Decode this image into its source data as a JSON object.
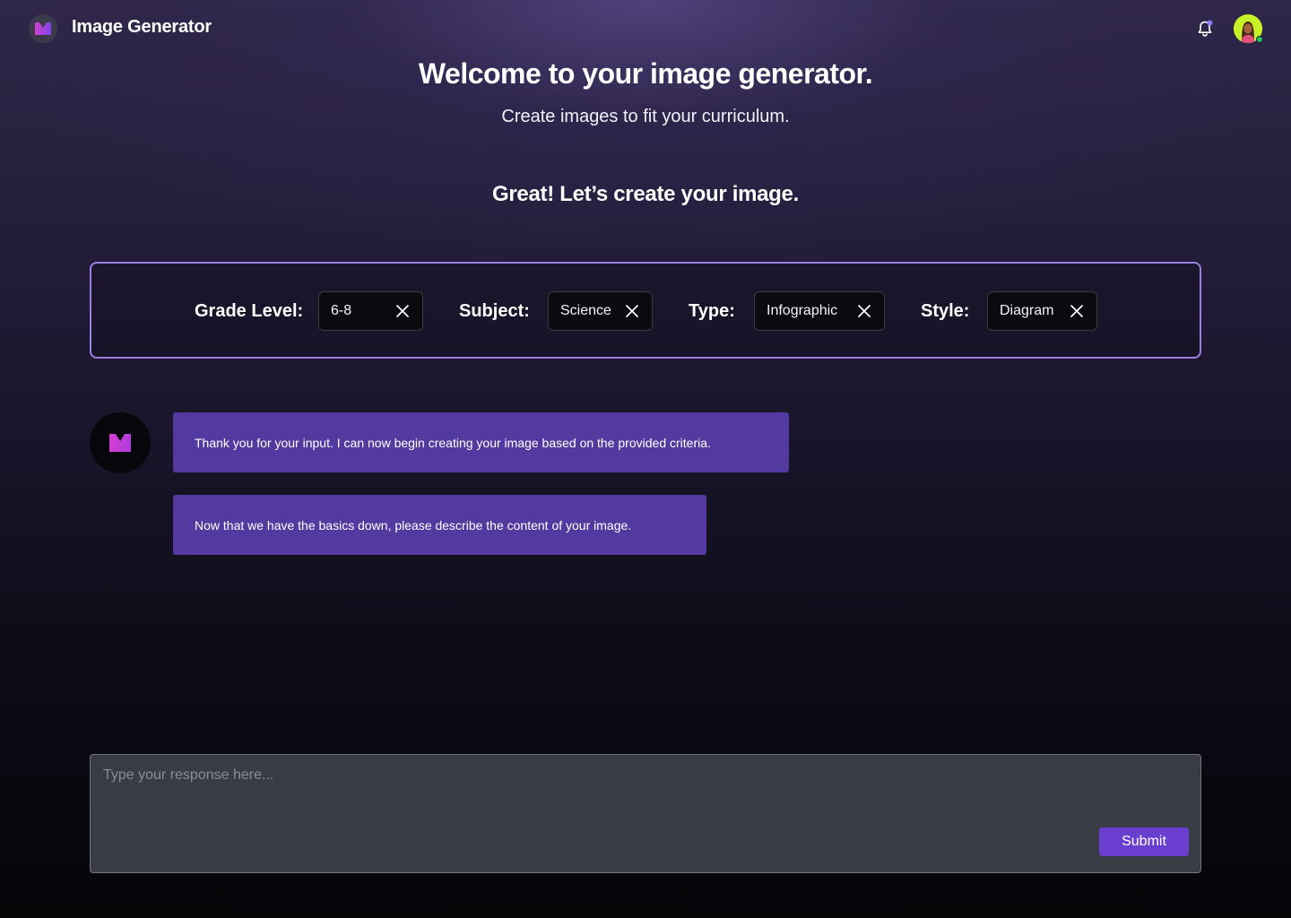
{
  "header": {
    "app_title": "Image Generator",
    "logo_icon": "m-logo-icon",
    "notification_icon": "bell-icon",
    "avatar": "user-avatar"
  },
  "hero": {
    "welcome": "Welcome to your image generator.",
    "subtitle": "Create images to fit your curriculum.",
    "prompt_title": "Great! Let’s create your image."
  },
  "criteria": {
    "grade_level": {
      "label": "Grade Level:",
      "value": "6-8"
    },
    "subject": {
      "label": "Subject:",
      "value": "Science"
    },
    "type": {
      "label": "Type:",
      "value": "Infographic"
    },
    "style": {
      "label": "Style:",
      "value": "Diagram"
    }
  },
  "chat": {
    "messages": [
      {
        "text": "Thank you for your input. I can now begin creating your image based on the provided criteria."
      },
      {
        "text": "Now that we have the basics down, please describe the content of your image."
      }
    ]
  },
  "input": {
    "placeholder": "Type your response here...",
    "value": "",
    "submit_label": "Submit"
  },
  "colors": {
    "accent": "#533aa0",
    "button": "#6a3fd0",
    "border_accent": "#9a7fe0",
    "logo_gradient_start": "#c43ad6",
    "logo_gradient_end": "#7a48e8",
    "avatar_bg": "#c6f227"
  }
}
